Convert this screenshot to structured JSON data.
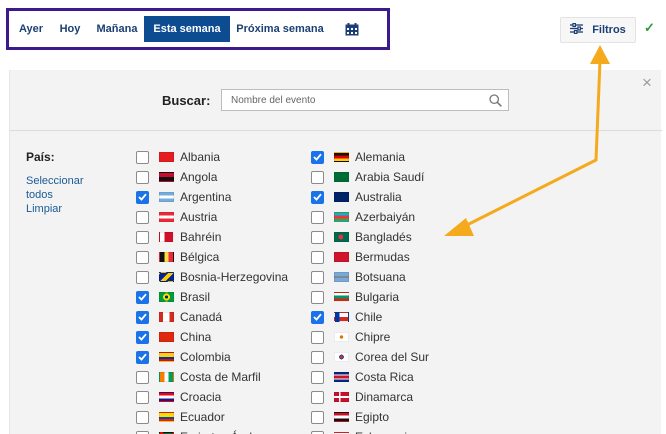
{
  "date_tabs": [
    {
      "label": "Ayer",
      "active": false
    },
    {
      "label": "Hoy",
      "active": false
    },
    {
      "label": "Mañana",
      "active": false
    },
    {
      "label": "Esta semana",
      "active": true
    },
    {
      "label": "Próxima semana",
      "active": false
    }
  ],
  "calendar_icon": "calendar-icon",
  "filters": {
    "label": "Filtros",
    "icon": "sliders-icon",
    "applied_icon": "checkmark-icon"
  },
  "panel": {
    "close_icon": "close-icon",
    "search": {
      "label": "Buscar:",
      "placeholder": "Nombre del evento",
      "value": "",
      "icon": "search-icon"
    },
    "country_label": "País:",
    "select_all": "Seleccionar todos",
    "clear": "Limpiar",
    "col1": [
      {
        "name": "Albania",
        "checked": false,
        "flag": "albania-flag"
      },
      {
        "name": "Angola",
        "checked": false,
        "flag": "angola-flag"
      },
      {
        "name": "Argentina",
        "checked": true,
        "flag": "argentina-flag"
      },
      {
        "name": "Austria",
        "checked": false,
        "flag": "austria-flag"
      },
      {
        "name": "Bahréin",
        "checked": false,
        "flag": "bahrain-flag"
      },
      {
        "name": "Bélgica",
        "checked": false,
        "flag": "belgium-flag"
      },
      {
        "name": "Bosnia-Herzegovina",
        "checked": false,
        "flag": "bosnia-flag"
      },
      {
        "name": "Brasil",
        "checked": true,
        "flag": "brazil-flag"
      },
      {
        "name": "Canadá",
        "checked": true,
        "flag": "canada-flag"
      },
      {
        "name": "China",
        "checked": true,
        "flag": "china-flag"
      },
      {
        "name": "Colombia",
        "checked": true,
        "flag": "colombia-flag"
      },
      {
        "name": "Costa de Marfil",
        "checked": false,
        "flag": "ivory-coast-flag"
      },
      {
        "name": "Croacia",
        "checked": false,
        "flag": "croatia-flag"
      },
      {
        "name": "Ecuador",
        "checked": false,
        "flag": "ecuador-flag"
      },
      {
        "name": "Emiratos Árabes",
        "checked": false,
        "flag": "uae-flag"
      }
    ],
    "col2": [
      {
        "name": "Alemania",
        "checked": true,
        "flag": "germany-flag"
      },
      {
        "name": "Arabia Saudí",
        "checked": false,
        "flag": "saudi-arabia-flag"
      },
      {
        "name": "Australia",
        "checked": true,
        "flag": "australia-flag"
      },
      {
        "name": "Azerbaiyán",
        "checked": false,
        "flag": "azerbaijan-flag"
      },
      {
        "name": "Bangladés",
        "checked": false,
        "flag": "bangladesh-flag"
      },
      {
        "name": "Bermudas",
        "checked": false,
        "flag": "bermuda-flag"
      },
      {
        "name": "Botsuana",
        "checked": false,
        "flag": "botswana-flag"
      },
      {
        "name": "Bulgaria",
        "checked": false,
        "flag": "bulgaria-flag"
      },
      {
        "name": "Chile",
        "checked": true,
        "flag": "chile-flag"
      },
      {
        "name": "Chipre",
        "checked": false,
        "flag": "cyprus-flag"
      },
      {
        "name": "Corea del Sur",
        "checked": false,
        "flag": "south-korea-flag"
      },
      {
        "name": "Costa Rica",
        "checked": false,
        "flag": "costa-rica-flag"
      },
      {
        "name": "Dinamarca",
        "checked": false,
        "flag": "denmark-flag"
      },
      {
        "name": "Egipto",
        "checked": false,
        "flag": "egypt-flag"
      },
      {
        "name": "Eslovaquia",
        "checked": false,
        "flag": "slovakia-flag"
      }
    ]
  },
  "colors": {
    "tabs_border": "#3c1a8c",
    "active_tab": "#0e4c92",
    "checkbox_checked": "#1a73e8",
    "annotation_arrow": "#f5a91c",
    "applied_check": "#2e9a3f"
  }
}
